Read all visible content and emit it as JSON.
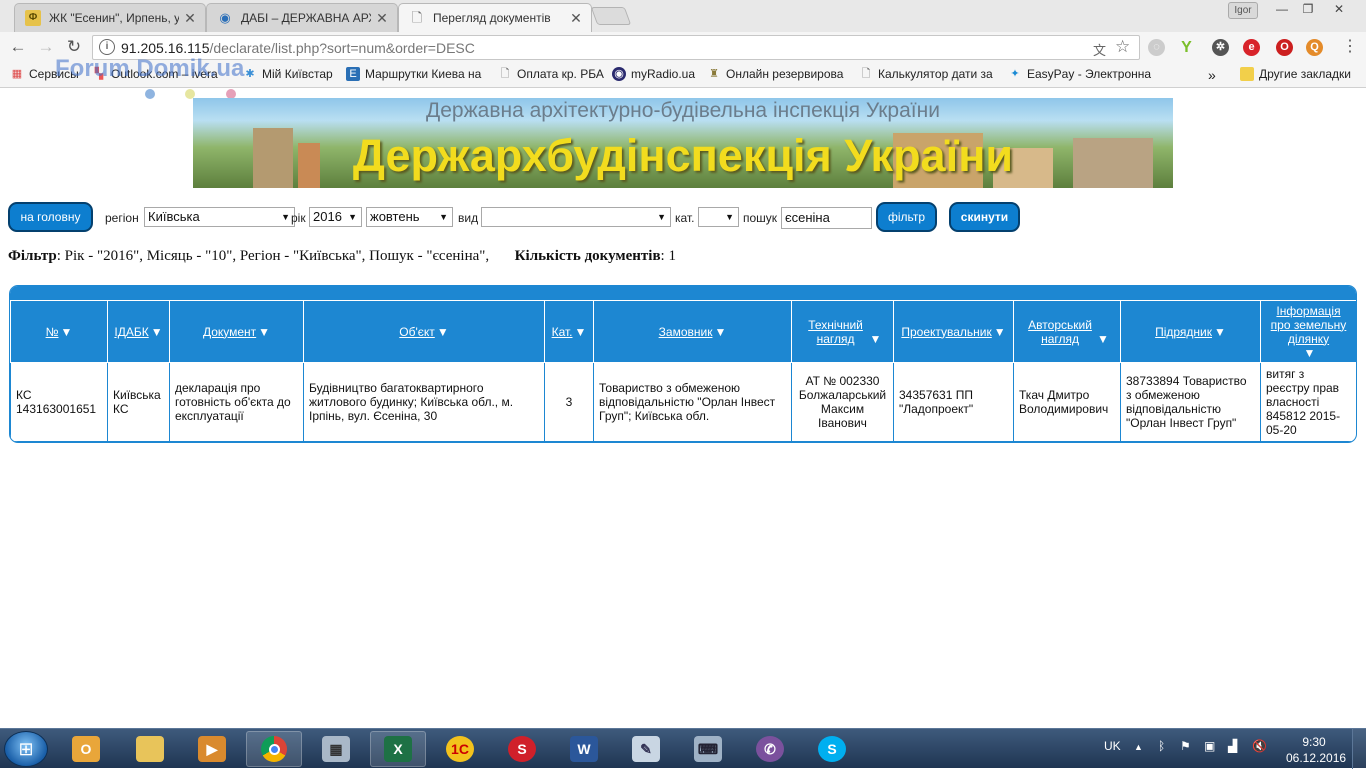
{
  "browser": {
    "tabs": [
      {
        "title": "ЖК \"Есенин\", Ирпень, у",
        "icon": "forum-icon"
      },
      {
        "title": "ДАБІ – ДЕРЖАВНА АРХІ",
        "icon": "globe-icon"
      },
      {
        "title": "Перегляд документів",
        "icon": "page-icon"
      }
    ],
    "profile": "Igor",
    "url_host": "91.205.16.115",
    "url_path": "/declarate/list.php?sort=num&order=DESC",
    "bookmarks": [
      "Сервисы",
      "Outlook.com – ivera",
      "Мій Київстар",
      "Маршрутки Киева на",
      "Оплата кр. РБА",
      "myRadio.ua",
      "Онлайн резервирова",
      "Калькулятор дати за",
      "EasyPay - Электронна"
    ],
    "bookmarks_more": "»",
    "other_bookmarks": "Другие закладки",
    "watermark": "Forum Domik.ua"
  },
  "banner": {
    "subtitle": "Державна архітектурно-будівельна інспекція України",
    "title": "Держархбудінспекція України"
  },
  "filter": {
    "home_button": "на головну",
    "region_label": "регіон",
    "region_value": "Київська",
    "year_label": "рік",
    "year_value": "2016",
    "month_value": "жовтень",
    "kind_label": "вид",
    "kind_value": "",
    "category_label": "кат.",
    "category_value": "",
    "search_label": "пошук",
    "search_value": "єсеніна",
    "filter_button": "фільтр",
    "reset_button": "скинути"
  },
  "summary": {
    "filter_label": "Фільтр",
    "filter_text": ": Рік - \"2016\", Місяць - \"10\", Регіон - \"Київська\", Пошук - \"єсеніна\",",
    "count_label": "Кількість документів",
    "count_value": ": 1"
  },
  "table": {
    "headers": [
      "№",
      "ІДАБК",
      "Документ",
      "Об'єкт",
      "Кат.",
      "Замовник",
      "Технічний нагляд",
      "Проектувальник",
      "Авторський нагляд",
      "Підрядник",
      "Інформація про земельну ділянку"
    ],
    "rows": [
      [
        "КС 143163001651",
        "Київська КС",
        "декларація про готовність об'єкта до експлуатації",
        "Будівництво багатоквартирного житлового будинку; Київська обл., м. Ірпінь, вул. Єсеніна, 30",
        "3",
        "Товариство з обмеженою відповідальністю \"Орлан Інвест Груп\"; Київська обл.",
        "АТ № 002330 Болжаларський Максим Іванович",
        "34357631 ПП \"Ладопроект\"",
        "Ткач Дмитро Володимирович",
        "38733894 Товариство з обмеженою відповідальністю \"Орлан Інвест Груп\"",
        "витяг з реєстру прав власності 845812 2015-05-20"
      ]
    ]
  },
  "taskbar": {
    "lang": "UK",
    "time": "9:30",
    "date": "06.12.2016"
  }
}
